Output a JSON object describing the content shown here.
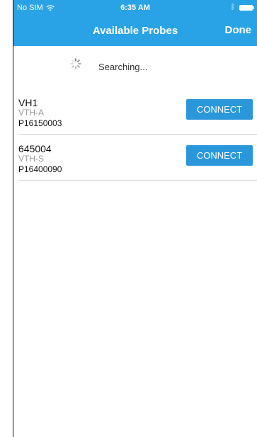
{
  "status_bar": {
    "carrier": "No SIM",
    "time": "6:35 AM",
    "icons": [
      "wifi-icon",
      "bluetooth-icon",
      "battery-icon"
    ]
  },
  "nav": {
    "title": "Available Probes",
    "done_label": "Done"
  },
  "search": {
    "status_text": "Searching...",
    "icon": "spinner-icon"
  },
  "probes": [
    {
      "name": "VH1",
      "model": "VTH-A",
      "serial": "P16150003",
      "connect_label": "CONNECT"
    },
    {
      "name": "645004",
      "model": "VTH-S",
      "serial": "P16400090",
      "connect_label": "CONNECT"
    }
  ],
  "colors": {
    "accent": "#2aa3e6",
    "button": "#2a97da",
    "muted_text": "#9a9a9a",
    "divider": "#d4d4d4"
  }
}
